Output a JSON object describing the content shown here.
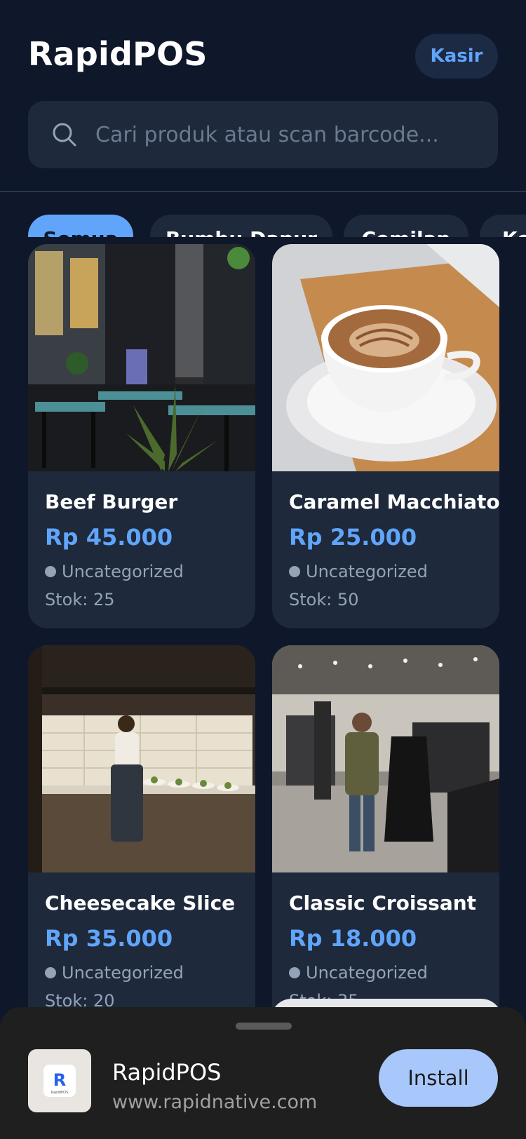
{
  "header": {
    "title": "RapidPOS",
    "kasir_label": "Kasir",
    "search_placeholder": "Cari produk atau scan barcode..."
  },
  "categories": [
    {
      "label": "Semua",
      "active": true
    },
    {
      "label": "Bumbu Dapur",
      "active": false
    },
    {
      "label": "Cemilan",
      "active": false
    },
    {
      "label": "Ke",
      "active": false
    }
  ],
  "products": [
    {
      "name": "Beef Burger",
      "price": "Rp 45.000",
      "category": "Uncategorized",
      "stock": "Stok: 25",
      "image": "restaurant-terrace"
    },
    {
      "name": "Caramel Macchiato",
      "price": "Rp 25.000",
      "category": "Uncategorized",
      "stock": "Stok: 50",
      "image": "latte-cup"
    },
    {
      "name": "Cheesecake Slice",
      "price": "Rp 35.000",
      "category": "Uncategorized",
      "stock": "Stok: 20",
      "image": "kitchen-chef"
    },
    {
      "name": "Classic Croissant",
      "price": "Rp 18.000",
      "category": "Uncategorized",
      "stock": "Stok: 35",
      "image": "clothing-store"
    }
  ],
  "install_banner": {
    "app_name": "RapidPOS",
    "url": "www.rapidnative.com",
    "install_label": "Install",
    "icon_letter": "R",
    "icon_caption": "RapidPOS"
  },
  "colors": {
    "background": "#0f172a",
    "card": "#1e293b",
    "accent": "#60a5fa",
    "muted": "#94a3b8",
    "install_button": "#a8c7fa"
  }
}
